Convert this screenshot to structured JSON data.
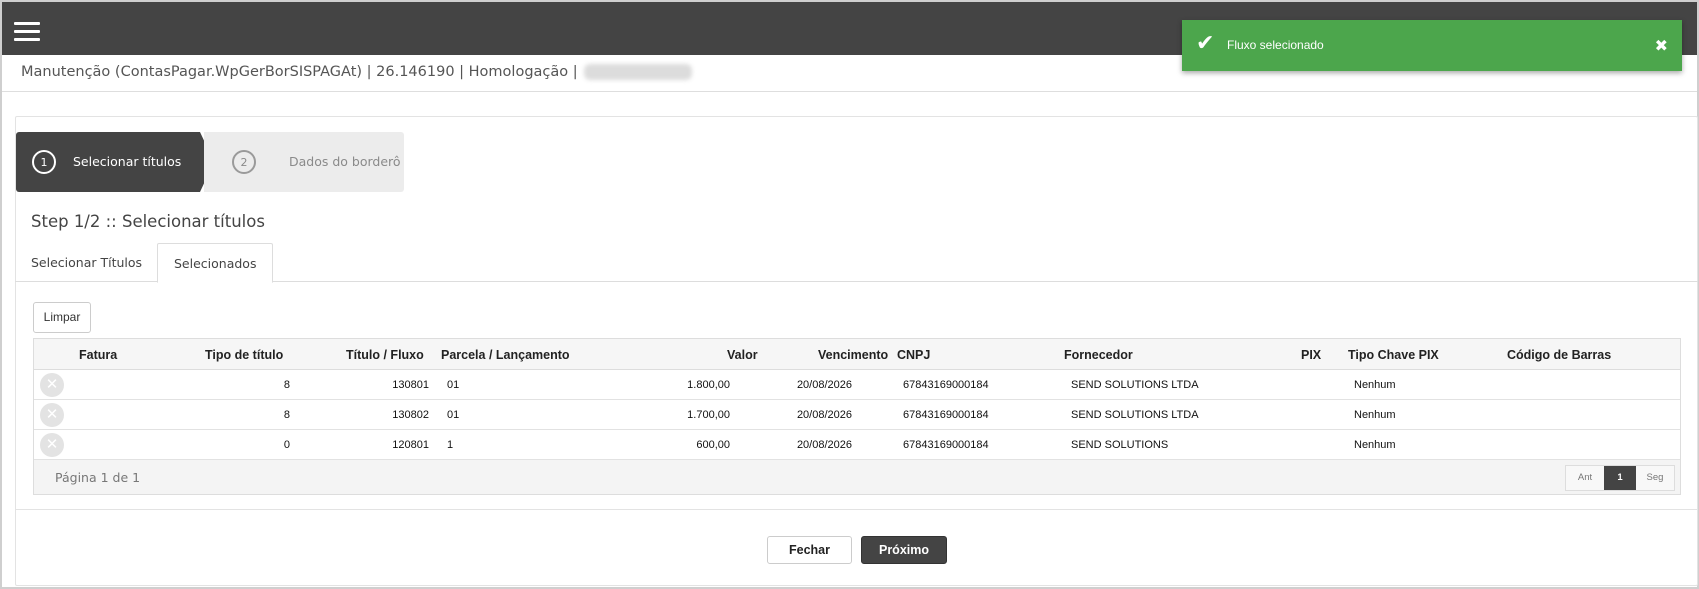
{
  "header": {
    "title": "Manutenção (ContasPagar.WpGerBorSISPAGAt) | 26.146190 | Homologação |"
  },
  "toast": {
    "message": "Fluxo selecionado",
    "color": "#4ca64c",
    "icon": "check-icon",
    "close_icon": "close-icon"
  },
  "wizard": {
    "steps": [
      {
        "number": "1",
        "label": "Selecionar títulos",
        "active": true
      },
      {
        "number": "2",
        "label": "Dados do borderô",
        "active": false
      }
    ]
  },
  "step_title": "Step 1/2 :: Selecionar títulos",
  "tabs": [
    {
      "label": "Selecionar Títulos",
      "active": false
    },
    {
      "label": "Selecionados",
      "active": true
    }
  ],
  "buttons": {
    "limpar": "Limpar",
    "fechar": "Fechar",
    "proximo": "Próximo"
  },
  "table": {
    "columns": [
      "Fatura",
      "Tipo de título",
      "Título / Fluxo",
      "Parcela / Lançamento",
      "Valor",
      "Vencimento",
      "CNPJ",
      "Fornecedor",
      "PIX",
      "Tipo Chave PIX",
      "Código de Barras"
    ],
    "rows": [
      {
        "fatura": "",
        "tipo": "8",
        "titulo": "130801",
        "parcela": "01",
        "valor": "1.800,00",
        "vencimento": "20/08/2026",
        "cnpj": "67843169000184",
        "fornecedor": "SEND SOLUTIONS LTDA",
        "pix": "",
        "tipo_chave": "Nenhum",
        "codigo": ""
      },
      {
        "fatura": "",
        "tipo": "8",
        "titulo": "130802",
        "parcela": "01",
        "valor": "1.700,00",
        "vencimento": "20/08/2026",
        "cnpj": "67843169000184",
        "fornecedor": "SEND SOLUTIONS LTDA",
        "pix": "",
        "tipo_chave": "Nenhum",
        "codigo": ""
      },
      {
        "fatura": "",
        "tipo": "0",
        "titulo": "120801",
        "parcela": "1",
        "valor": "600,00",
        "vencimento": "20/08/2026",
        "cnpj": "67843169000184",
        "fornecedor": "SEND SOLUTIONS",
        "pix": "",
        "tipo_chave": "Nenhum",
        "codigo": ""
      }
    ]
  },
  "pager": {
    "info": "Página 1 de 1",
    "prev": "Ant",
    "current": "1",
    "next": "Seg"
  },
  "colors": {
    "dark": "#444444",
    "success": "#4ca64c"
  }
}
